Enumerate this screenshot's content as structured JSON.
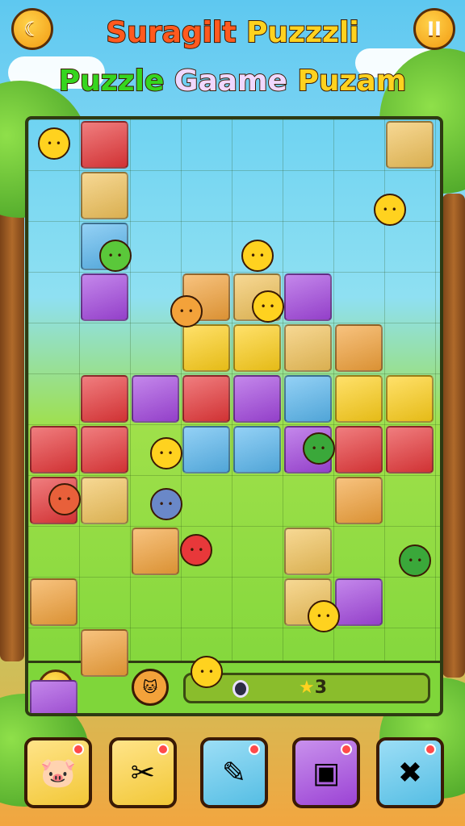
{
  "title": {
    "line1": [
      {
        "text": "Suragilt ",
        "color": "#ff5a1f"
      },
      {
        "text": "Puzzzli",
        "color": "#ffd21f"
      }
    ],
    "line2": [
      {
        "text": "Puzzle ",
        "color": "#35d61f"
      },
      {
        "text": "Gaame ",
        "color": "#f0d8ff"
      },
      {
        "text": "Puzam",
        "color": "#ffd21f"
      }
    ]
  },
  "header": {
    "left_button_icon": "moon-icon",
    "pause_button_icon": "pause-icon",
    "left_glyph": "☾",
    "pause_glyph": "II"
  },
  "hud": {
    "star_icon": "star-icon",
    "gem_count": "0",
    "star_count": "3",
    "star_glyph": "★"
  },
  "board": {
    "rows": 12,
    "cols": 8,
    "colors": {
      "red": "#e8383a",
      "purple": "#a447e0",
      "yellow": "#ffd01a",
      "orange": "#f3a23a",
      "blue": "#5ab8f0",
      "sand": "#f2c35a"
    }
  },
  "powerups": [
    {
      "name": "pink-creature",
      "icon": "pink-creature-icon",
      "bg": "#ffd23a",
      "glyph": "🐷"
    },
    {
      "name": "shovel",
      "icon": "shovel-icon",
      "bg": "#ffd23a",
      "glyph": "✂"
    },
    {
      "name": "magic-wand",
      "icon": "wand-icon",
      "bg": "#5ac8f0",
      "glyph": "✎"
    },
    {
      "name": "gift-box",
      "icon": "box-icon",
      "bg": "#a447e0",
      "glyph": "▣"
    },
    {
      "name": "hammer",
      "icon": "hammer-icon",
      "bg": "#5ac8f0",
      "glyph": "✖"
    }
  ]
}
